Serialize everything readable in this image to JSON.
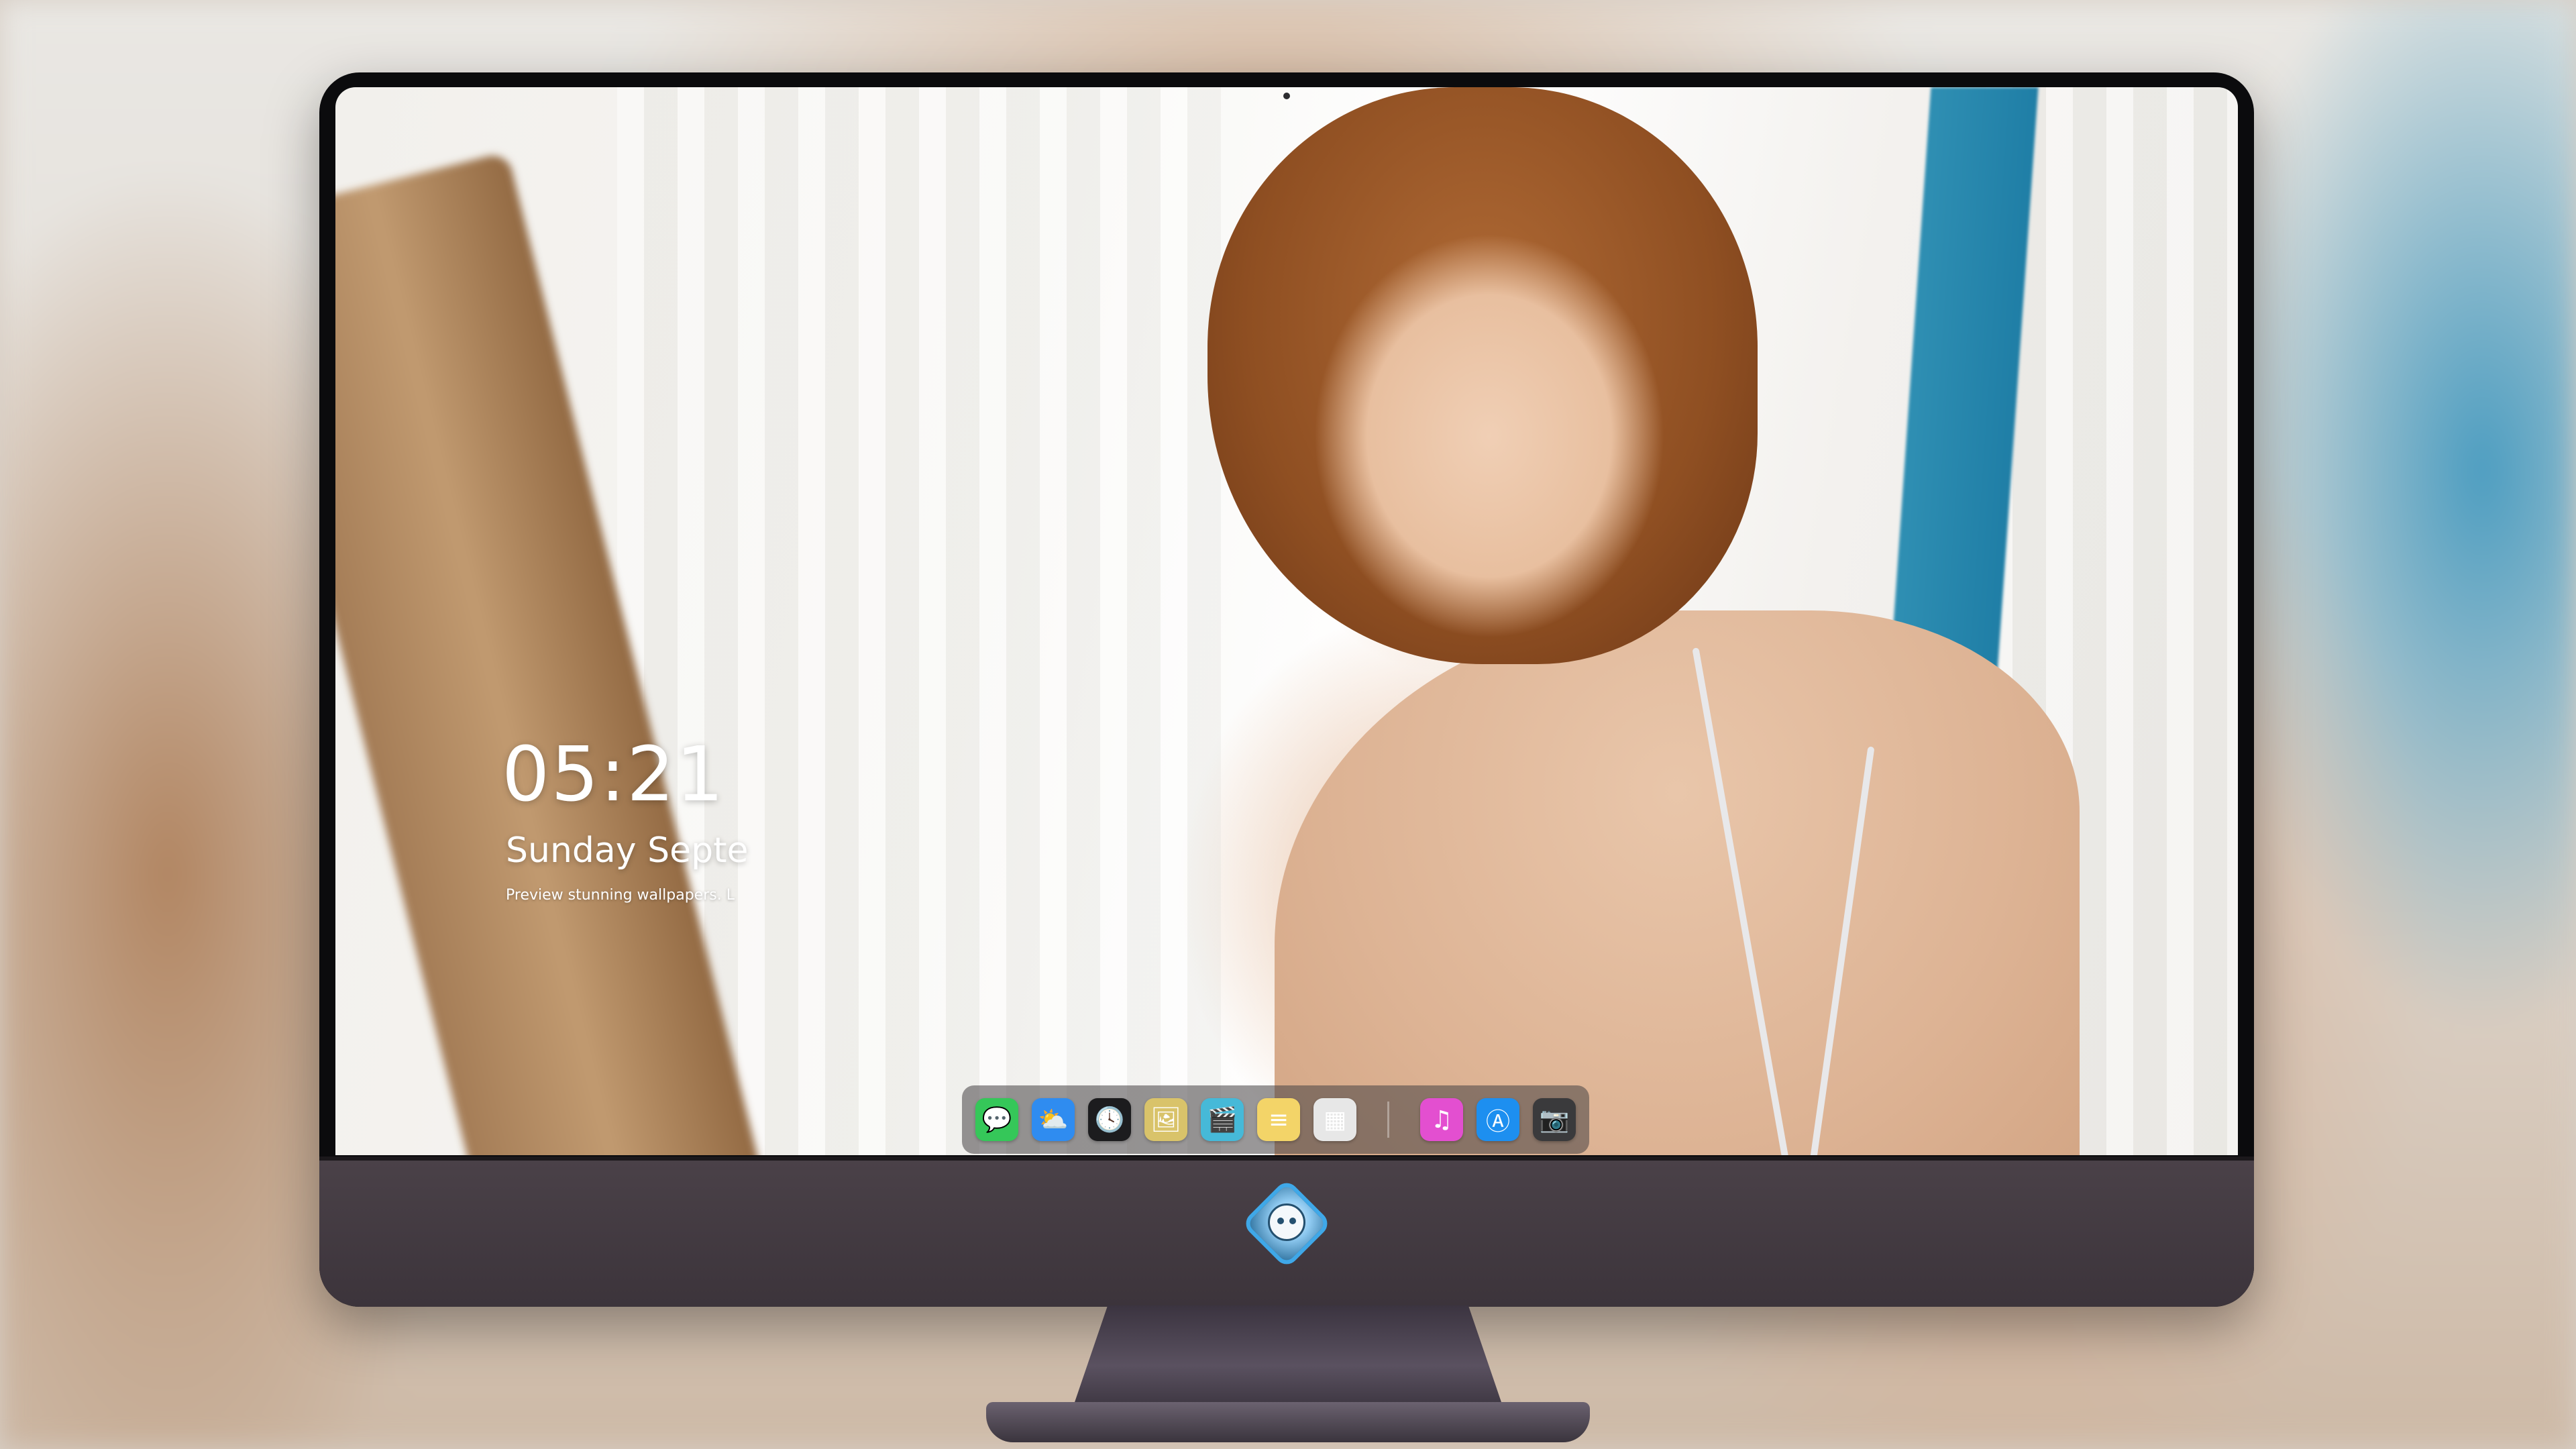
{
  "lock_screen": {
    "time": "05:21",
    "date": "Sunday Septe",
    "tagline": "Preview stunning wallpapers. L"
  },
  "dock": {
    "apps": [
      {
        "name": "messages-icon",
        "glyph": "💬",
        "color": "#35c759"
      },
      {
        "name": "weather-icon",
        "glyph": "⛅",
        "color": "#2f8cf0"
      },
      {
        "name": "clock-icon",
        "glyph": "🕓",
        "color": "#1c1c1e"
      },
      {
        "name": "preview-icon",
        "glyph": "🖼",
        "color": "#d9c36a"
      },
      {
        "name": "video-clips-icon",
        "glyph": "🎬",
        "color": "#46b9d8"
      },
      {
        "name": "notes-icon",
        "glyph": "≡",
        "color": "#f3d468"
      },
      {
        "name": "photo-booth-icon",
        "glyph": "▦",
        "color": "#e7e7e7"
      },
      {
        "name": "music-icon",
        "glyph": "♫",
        "color": "#e34fd0"
      },
      {
        "name": "app-store-icon",
        "glyph": "Ⓐ",
        "color": "#1d8ff0"
      },
      {
        "name": "camera-icon",
        "glyph": "📷",
        "color": "#3a3a3c"
      }
    ]
  },
  "colors": {
    "dock_background": "rgba(70,66,68,0.55)",
    "monitor_chin": "#3c343b",
    "logo_accent": "#3fa8e8"
  }
}
